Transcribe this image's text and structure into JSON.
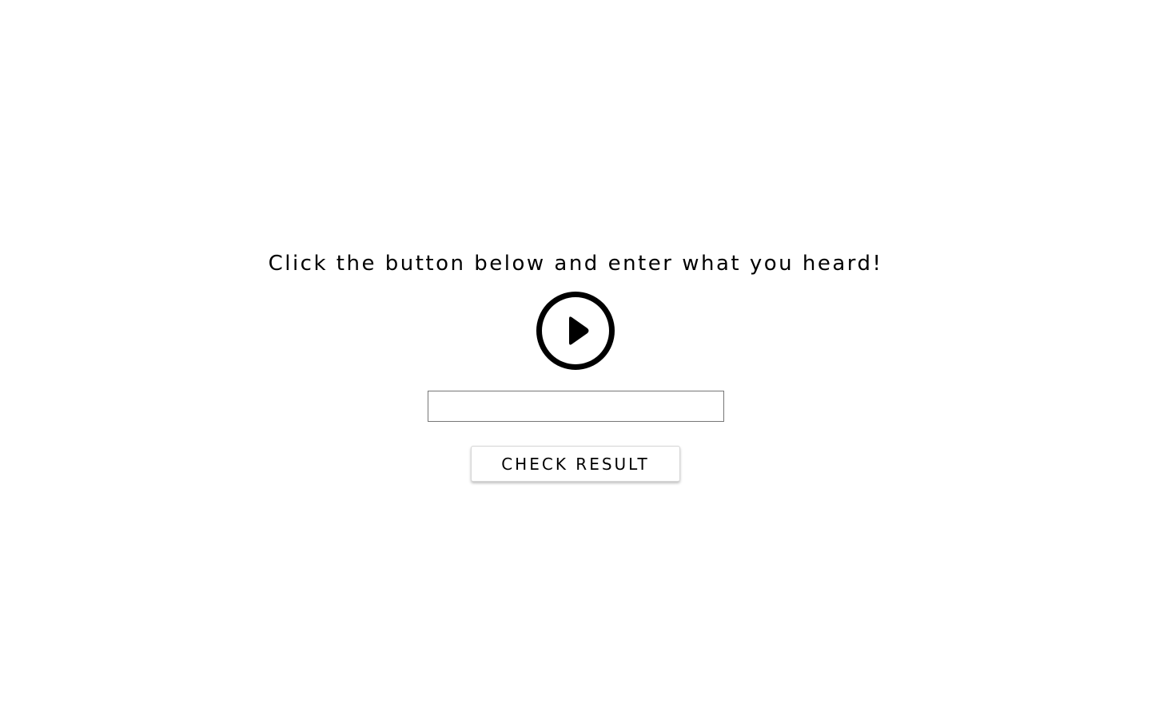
{
  "instruction": {
    "text": "Click the button below and enter what you heard!"
  },
  "play": {
    "icon": "play-circle-icon",
    "color": "#000000"
  },
  "answer": {
    "value": "",
    "placeholder": ""
  },
  "check": {
    "label": "CHECK RESULT"
  }
}
